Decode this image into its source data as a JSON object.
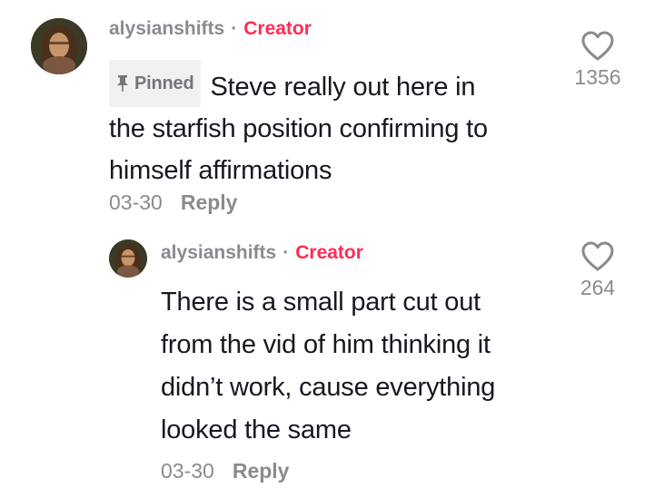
{
  "comment": {
    "username": "alysianshifts",
    "separator": "·",
    "creator_label": "Creator",
    "pinned_label": "Pinned",
    "text_line1": "Steve really out here in",
    "text_line2": "the starfish position confirming to",
    "text_line3": "himself affirmations",
    "date": "03-30",
    "reply_label": "Reply",
    "like_count": "1356",
    "icons": {
      "pin": "pin-icon",
      "like": "heart-outline-icon"
    }
  },
  "reply_comment": {
    "username": "alysianshifts",
    "separator": "·",
    "creator_label": "Creator",
    "text_line1": "There is a small part cut out",
    "text_line2": "from the vid of him thinking it",
    "text_line3": "didn’t work, cause everything",
    "text_line4": "looked the same",
    "date": "03-30",
    "reply_label": "Reply",
    "like_count": "264",
    "icons": {
      "like": "heart-outline-icon"
    }
  },
  "colors": {
    "creator_accent": "#fe2c55",
    "muted_text": "#8a8b91",
    "primary_text": "#161823",
    "pinned_bg": "#f1f1f2"
  }
}
